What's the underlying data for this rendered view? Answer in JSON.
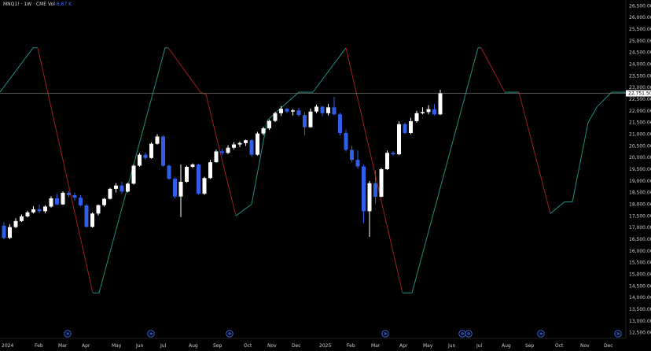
{
  "header": {
    "symbol": "MNQ1!",
    "separator1": "·",
    "interval": "1W",
    "separator2": "·",
    "exchange": "CME",
    "volume_label": "Vol",
    "volume_value": "6.67 K"
  },
  "price_axis": {
    "labels": [
      "26,500.00",
      "26,000.00",
      "25,500.00",
      "25,000.00",
      "24,500.00",
      "24,000.00",
      "23,500.00",
      "23,000.00",
      "22,500.00",
      "22,000.00",
      "21,500.00",
      "21,000.00",
      "20,500.00",
      "20,000.00",
      "19,500.00",
      "19,000.00",
      "18,500.00",
      "18,000.00",
      "17,500.00",
      "17,000.00",
      "16,500.00",
      "16,000.00",
      "15,500.00",
      "15,000.00",
      "14,500.00",
      "14,000.00",
      "13,500.00",
      "13,000.00",
      "12,500.00"
    ],
    "current_price": "22,751.50"
  },
  "time_axis": {
    "labels": [
      "2024",
      "Feb",
      "Mar",
      "Apr",
      "May",
      "Jun",
      "Jul",
      "Aug",
      "Sep",
      "Oct",
      "Nov",
      "Dec",
      "2025",
      "Feb",
      "Mar",
      "Apr",
      "May",
      "Jun",
      "Jul",
      "Aug",
      "Sep",
      "Oct",
      "Nov",
      "Dec"
    ]
  },
  "colors": {
    "background": "#000000",
    "bull": "#ffffff",
    "bear": "#2f5ee8",
    "indicator_up": "#1f8f84",
    "indicator_down": "#a11c1c",
    "price_line": "#8c8c8c",
    "marker": "#3b63d9"
  },
  "icons": {
    "event_marker": "dividend-icon"
  },
  "chart_data": {
    "type": "candlestick",
    "title": "MNQ1! · 1W · CME",
    "y_axis_range": [
      12250,
      26750
    ],
    "current_price": 22751.5,
    "x_tick_labels": [
      "2024",
      "Feb",
      "Mar",
      "Apr",
      "May",
      "Jun",
      "Jul",
      "Aug",
      "Sep",
      "Oct",
      "Nov",
      "Dec",
      "2025",
      "Feb",
      "Mar",
      "Apr",
      "May",
      "Jun",
      "Jul",
      "Aug",
      "Sep",
      "Oct",
      "Nov",
      "Dec"
    ],
    "candles": [
      {
        "o": 17080,
        "h": 17240,
        "l": 16500,
        "c": 16560
      },
      {
        "o": 16560,
        "h": 17150,
        "l": 16500,
        "c": 17020
      },
      {
        "o": 17020,
        "h": 17400,
        "l": 16980,
        "c": 17280
      },
      {
        "o": 17280,
        "h": 17560,
        "l": 17240,
        "c": 17480
      },
      {
        "o": 17480,
        "h": 17720,
        "l": 17440,
        "c": 17650
      },
      {
        "o": 17650,
        "h": 17920,
        "l": 17600,
        "c": 17780
      },
      {
        "o": 17780,
        "h": 18000,
        "l": 17620,
        "c": 17700
      },
      {
        "o": 17700,
        "h": 17960,
        "l": 17620,
        "c": 17900
      },
      {
        "o": 17900,
        "h": 18340,
        "l": 17850,
        "c": 18250
      },
      {
        "o": 18250,
        "h": 18450,
        "l": 17960,
        "c": 17990
      },
      {
        "o": 17990,
        "h": 18550,
        "l": 17970,
        "c": 18490
      },
      {
        "o": 18490,
        "h": 18560,
        "l": 18300,
        "c": 18390
      },
      {
        "o": 18390,
        "h": 18500,
        "l": 18150,
        "c": 18280
      },
      {
        "o": 18280,
        "h": 18400,
        "l": 17900,
        "c": 17950
      },
      {
        "o": 17950,
        "h": 18020,
        "l": 17000,
        "c": 17030
      },
      {
        "o": 17030,
        "h": 17650,
        "l": 17000,
        "c": 17600
      },
      {
        "o": 17600,
        "h": 17990,
        "l": 17520,
        "c": 17960
      },
      {
        "o": 17960,
        "h": 18270,
        "l": 17900,
        "c": 18230
      },
      {
        "o": 18230,
        "h": 18700,
        "l": 18200,
        "c": 18660
      },
      {
        "o": 18660,
        "h": 18900,
        "l": 18500,
        "c": 18800
      },
      {
        "o": 18800,
        "h": 18960,
        "l": 18450,
        "c": 18540
      },
      {
        "o": 18540,
        "h": 18920,
        "l": 18500,
        "c": 18880
      },
      {
        "o": 18880,
        "h": 19700,
        "l": 18840,
        "c": 19650
      },
      {
        "o": 19650,
        "h": 20200,
        "l": 19600,
        "c": 20120
      },
      {
        "o": 20120,
        "h": 20220,
        "l": 19920,
        "c": 19980
      },
      {
        "o": 19980,
        "h": 20650,
        "l": 19950,
        "c": 20590
      },
      {
        "o": 20590,
        "h": 21000,
        "l": 20550,
        "c": 20900
      },
      {
        "o": 20900,
        "h": 20960,
        "l": 19600,
        "c": 19650
      },
      {
        "o": 19650,
        "h": 19700,
        "l": 19050,
        "c": 19090
      },
      {
        "o": 19090,
        "h": 19150,
        "l": 18250,
        "c": 18330
      },
      {
        "o": 18330,
        "h": 19700,
        "l": 17450,
        "c": 18960
      },
      {
        "o": 18960,
        "h": 19650,
        "l": 18920,
        "c": 19600
      },
      {
        "o": 19600,
        "h": 19750,
        "l": 19550,
        "c": 19700
      },
      {
        "o": 19700,
        "h": 19740,
        "l": 18400,
        "c": 18450
      },
      {
        "o": 18450,
        "h": 19180,
        "l": 18400,
        "c": 19120
      },
      {
        "o": 19120,
        "h": 19900,
        "l": 19080,
        "c": 19800
      },
      {
        "o": 19800,
        "h": 20340,
        "l": 19780,
        "c": 20260
      },
      {
        "o": 20260,
        "h": 20370,
        "l": 20100,
        "c": 20200
      },
      {
        "o": 20200,
        "h": 20530,
        "l": 20150,
        "c": 20420
      },
      {
        "o": 20420,
        "h": 20660,
        "l": 20350,
        "c": 20560
      },
      {
        "o": 20560,
        "h": 20690,
        "l": 20450,
        "c": 20620
      },
      {
        "o": 20620,
        "h": 20770,
        "l": 20500,
        "c": 20740
      },
      {
        "o": 20740,
        "h": 20780,
        "l": 20050,
        "c": 20120
      },
      {
        "o": 20120,
        "h": 21100,
        "l": 20080,
        "c": 21030
      },
      {
        "o": 21030,
        "h": 21320,
        "l": 20950,
        "c": 21250
      },
      {
        "o": 21250,
        "h": 21620,
        "l": 21180,
        "c": 21570
      },
      {
        "o": 21570,
        "h": 21960,
        "l": 21520,
        "c": 21900
      },
      {
        "o": 21900,
        "h": 22200,
        "l": 21780,
        "c": 22090
      },
      {
        "o": 22090,
        "h": 22130,
        "l": 21900,
        "c": 21970
      },
      {
        "o": 21970,
        "h": 22080,
        "l": 21800,
        "c": 22020
      },
      {
        "o": 22020,
        "h": 22140,
        "l": 21750,
        "c": 21820
      },
      {
        "o": 21820,
        "h": 21950,
        "l": 20950,
        "c": 21300
      },
      {
        "o": 21300,
        "h": 22100,
        "l": 21280,
        "c": 21970
      },
      {
        "o": 21970,
        "h": 22270,
        "l": 21900,
        "c": 22180
      },
      {
        "o": 22180,
        "h": 22210,
        "l": 21770,
        "c": 21900
      },
      {
        "o": 21900,
        "h": 22300,
        "l": 21800,
        "c": 22150
      },
      {
        "o": 22150,
        "h": 22600,
        "l": 21820,
        "c": 21850
      },
      {
        "o": 21850,
        "h": 21920,
        "l": 20950,
        "c": 21050
      },
      {
        "o": 21050,
        "h": 21200,
        "l": 20250,
        "c": 20330
      },
      {
        "o": 20330,
        "h": 20500,
        "l": 19800,
        "c": 19900
      },
      {
        "o": 19900,
        "h": 20300,
        "l": 19520,
        "c": 19620
      },
      {
        "o": 19620,
        "h": 19700,
        "l": 17200,
        "c": 17700
      },
      {
        "o": 17700,
        "h": 19000,
        "l": 16600,
        "c": 18900
      },
      {
        "o": 18900,
        "h": 19450,
        "l": 18020,
        "c": 18320
      },
      {
        "o": 18320,
        "h": 19560,
        "l": 18300,
        "c": 19500
      },
      {
        "o": 19500,
        "h": 20300,
        "l": 19460,
        "c": 20200
      },
      {
        "o": 20200,
        "h": 20270,
        "l": 20080,
        "c": 20140
      },
      {
        "o": 20140,
        "h": 21550,
        "l": 20100,
        "c": 21430
      },
      {
        "o": 21430,
        "h": 21500,
        "l": 21000,
        "c": 21050
      },
      {
        "o": 21050,
        "h": 21700,
        "l": 21000,
        "c": 21560
      },
      {
        "o": 21560,
        "h": 22000,
        "l": 21500,
        "c": 21900
      },
      {
        "o": 21900,
        "h": 22150,
        "l": 21850,
        "c": 21950
      },
      {
        "o": 21950,
        "h": 22240,
        "l": 21850,
        "c": 22070
      },
      {
        "o": 22070,
        "h": 22290,
        "l": 21800,
        "c": 21850
      },
      {
        "o": 21850,
        "h": 22900,
        "l": 21820,
        "c": 22751.5
      }
    ]
  }
}
